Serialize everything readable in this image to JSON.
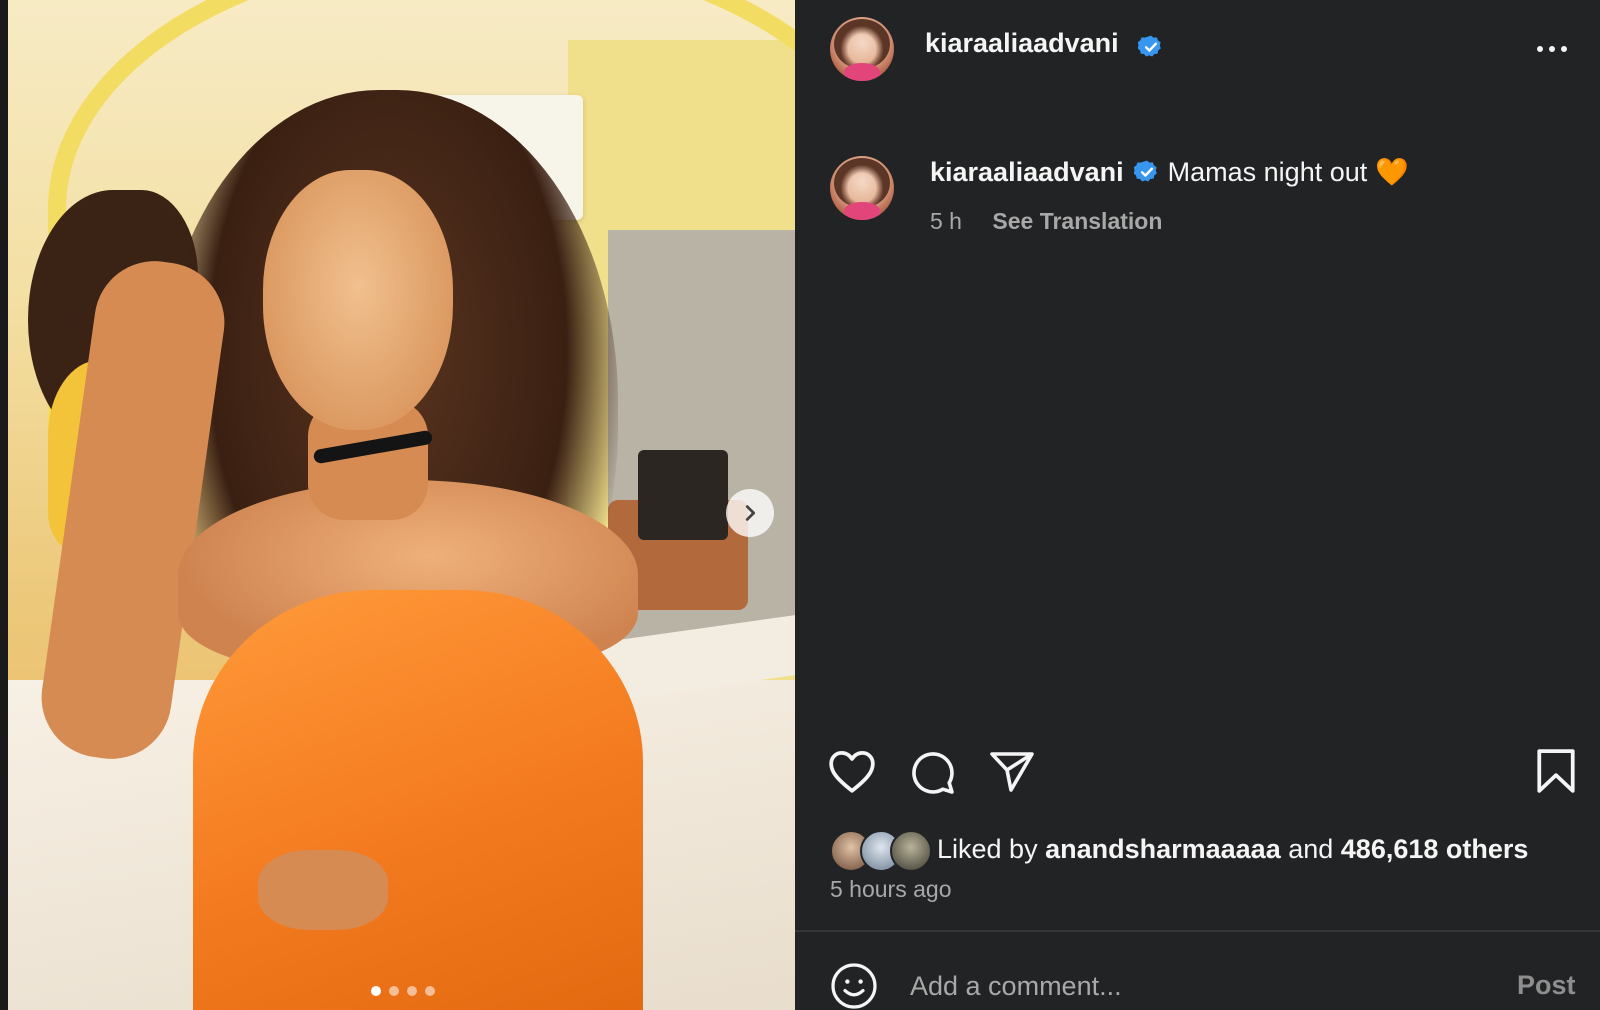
{
  "header": {
    "username": "kiaraaliaadvani",
    "verified": true,
    "verified_icon": "verified-badge-icon",
    "more_icon": "more-options-icon"
  },
  "caption": {
    "username": "kiaraaliaadvani",
    "verified": true,
    "text": "Mamas night out",
    "emoji": "🧡",
    "time": "5 h",
    "translate_label": "See Translation"
  },
  "media": {
    "description_icon": "photo",
    "next_icon": "chevron-right-icon",
    "slide_count": 4,
    "active_slide": 1
  },
  "actions": {
    "like_icon": "heart-icon",
    "comment_icon": "comment-bubble-icon",
    "share_icon": "paper-plane-icon",
    "save_icon": "bookmark-icon"
  },
  "likes": {
    "prefix": "Liked by ",
    "user": "anandsharmaaaaa",
    "conjunction": " and ",
    "others": "486,618 others"
  },
  "post_age": "5 hours ago",
  "comment": {
    "placeholder": "Add a comment...",
    "post_label": "Post",
    "emoji_icon": "smiley-icon"
  },
  "colors": {
    "panel_bg": "#222325",
    "verified_blue": "#3797f0",
    "text": "#f5f5f5",
    "muted": "#a8a8a8",
    "post_disabled": "#8e8e8e"
  }
}
